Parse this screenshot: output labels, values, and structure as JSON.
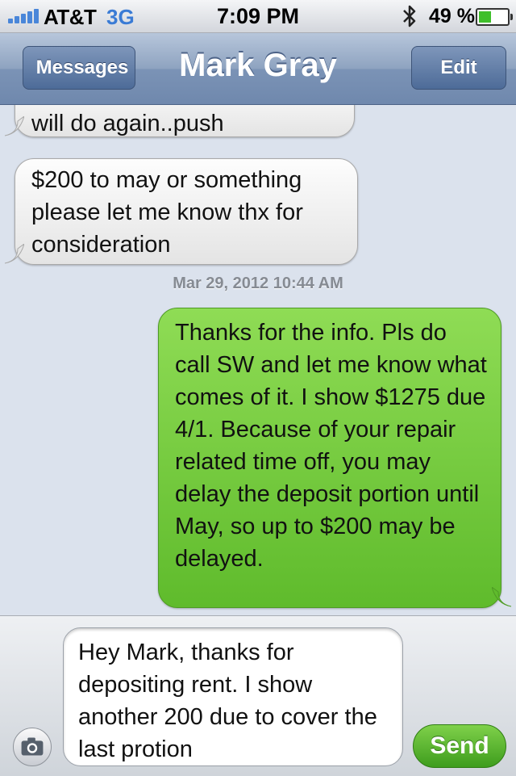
{
  "status_bar": {
    "carrier": "AT&T",
    "network": "3G",
    "time": "7:09 PM",
    "battery_percent": "49 %",
    "battery_level": 0.49,
    "icons": [
      "signal-bars-icon",
      "bluetooth-icon",
      "battery-icon"
    ]
  },
  "nav": {
    "back_label": "Messages",
    "title": "Mark Gray",
    "edit_label": "Edit"
  },
  "messages": [
    {
      "direction": "incoming",
      "text": "will do again..push"
    },
    {
      "direction": "incoming",
      "text": "$200 to may or something please let me know thx for consideration"
    },
    {
      "type": "timestamp",
      "text": "Mar 29, 2012 10:44 AM"
    },
    {
      "direction": "outgoing",
      "text": "Thanks for the info. Pls do call SW and let me know what comes of it. I show $1275 due 4/1. Because of your repair related time off, you may delay the deposit portion until May, so up to $200 may be delayed."
    }
  ],
  "compose": {
    "draft_text": "Hey Mark, thanks for depositing rent. I show another 200 due to cover the last protion",
    "send_label": "Send",
    "camera_icon": "camera-icon"
  },
  "colors": {
    "nav_blue": "#7b93b6",
    "outgoing_green": "#5fbb2c",
    "incoming_gray": "#e4e4e4",
    "thread_bg": "#dbe2ed",
    "send_green": "#3e9d1d"
  }
}
